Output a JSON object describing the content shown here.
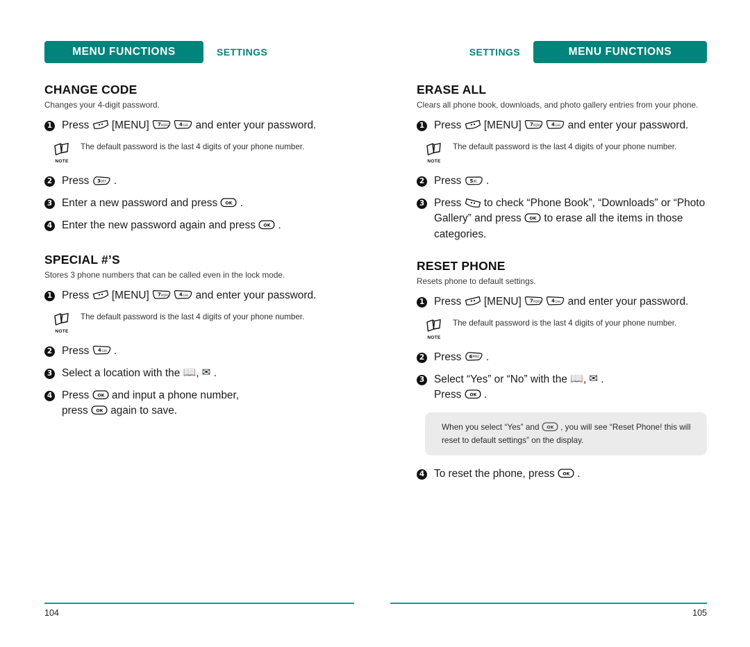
{
  "left_page": {
    "header": {
      "chip": "MENU FUNCTIONS",
      "label": "SETTINGS"
    },
    "sections": [
      {
        "title": "CHANGE CODE",
        "desc": "Changes your 4-digit password.",
        "steps": [
          {
            "num": "1",
            "text_a": "Press",
            "key1": "softkey-left",
            "text_b": "[MENU]",
            "key2": "7",
            "key2_sub": "PQRS",
            "key3": "4",
            "key3_sub": "GHI",
            "text_c": "and enter your password."
          },
          {
            "num": "2",
            "text_a": "Press",
            "key1": "3",
            "key1_sub": "DEF",
            "text_b": "."
          },
          {
            "num": "3",
            "text_a": "Enter a new password and press",
            "key1": "ok",
            "text_b": "."
          },
          {
            "num": "4",
            "text_a": "Enter the new password again and press",
            "key1": "ok",
            "text_b": "."
          }
        ],
        "note": {
          "caption": "NOTE",
          "text": "The default password is the last 4 digits of your phone number."
        }
      },
      {
        "title": "SPECIAL #’S",
        "desc": "Stores 3 phone numbers that can be called even in the lock mode.",
        "steps": [
          {
            "num": "1",
            "text_a": "Press",
            "key1": "softkey-left",
            "text_b": "[MENU]",
            "key2": "7",
            "key2_sub": "PQRS",
            "key3": "4",
            "key3_sub": "GHI",
            "text_c": "and enter your password."
          },
          {
            "num": "2",
            "text_a": "Press",
            "key1": "4",
            "key1_sub": "GHI",
            "text_b": "."
          },
          {
            "num": "3",
            "text_a": "Select a location with the",
            "icon_book": "book-icon",
            "sep": ",",
            "icon_env": "envelope-icon",
            "text_b": "."
          },
          {
            "num": "4",
            "text_a": "Press",
            "key1": "ok",
            "text_b": "and input a phone number,",
            "text_c": "press",
            "key2": "ok",
            "text_d": "again to save."
          }
        ],
        "note": {
          "caption": "NOTE",
          "text": "The default password is the last 4 digits of your phone number."
        }
      }
    ],
    "footer": {
      "page": "104"
    }
  },
  "right_page": {
    "header": {
      "chip": "MENU FUNCTIONS",
      "label": "SETTINGS"
    },
    "sections": [
      {
        "title": "ERASE ALL",
        "desc": "Clears all phone book, downloads, and photo gallery entries from your phone.",
        "steps": [
          {
            "num": "1",
            "text_a": "Press",
            "key1": "softkey-left",
            "text_b": "[MENU]",
            "key2": "7",
            "key2_sub": "PQRS",
            "key3": "4",
            "key3_sub": "GHI",
            "text_c": "and enter your password."
          },
          {
            "num": "2",
            "text_a": "Press",
            "key1": "5",
            "key1_sub": "JKL",
            "text_b": "."
          },
          {
            "num": "3",
            "text_a": "Press",
            "key1": "softkey-right",
            "text_b": "to check “Phone Book”, “Downloads” or “Photo Gallery” and press",
            "key2": "ok",
            "text_c": "to erase all the items in those categories."
          }
        ],
        "note": {
          "caption": "NOTE",
          "text": "The default password is the last 4 digits of your phone number."
        }
      },
      {
        "title": "RESET PHONE",
        "desc": "Resets phone to default settings.",
        "steps": [
          {
            "num": "1",
            "text_a": "Press",
            "key1": "softkey-left",
            "text_b": "[MENU]",
            "key2": "7",
            "key2_sub": "PQRS",
            "key3": "4",
            "key3_sub": "GHI",
            "text_c": "and enter your password."
          },
          {
            "num": "2",
            "text_a": "Press",
            "key1": "6",
            "key1_sub": "MNO",
            "text_b": "."
          },
          {
            "num": "3",
            "text_a": "Select “Yes” or “No” with the",
            "icon_book": "book-icon",
            "sep": ",",
            "icon_env": "envelope-icon",
            "text_b": ".",
            "text_c": "Press",
            "key2": "ok",
            "text_d": "."
          },
          {
            "num": "4",
            "text_a": "To reset the phone, press",
            "key1": "ok",
            "text_b": "."
          }
        ],
        "note": {
          "caption": "NOTE",
          "text": "The default password is the last 4 digits of your phone number."
        },
        "tip": {
          "text_a": "When you select “Yes” and",
          "key": "ok",
          "text_b": ", you will see “Reset Phone! this will reset to default settings” on the display."
        }
      }
    ],
    "footer": {
      "page": "105"
    }
  },
  "colors": {
    "brand_teal": "#00847C",
    "rule_teal": "#17968F",
    "tip_grey": "#ebebeb",
    "text": "#1b1b1b"
  },
  "glyphs": {
    "book": "📖",
    "envelope": "✉"
  }
}
